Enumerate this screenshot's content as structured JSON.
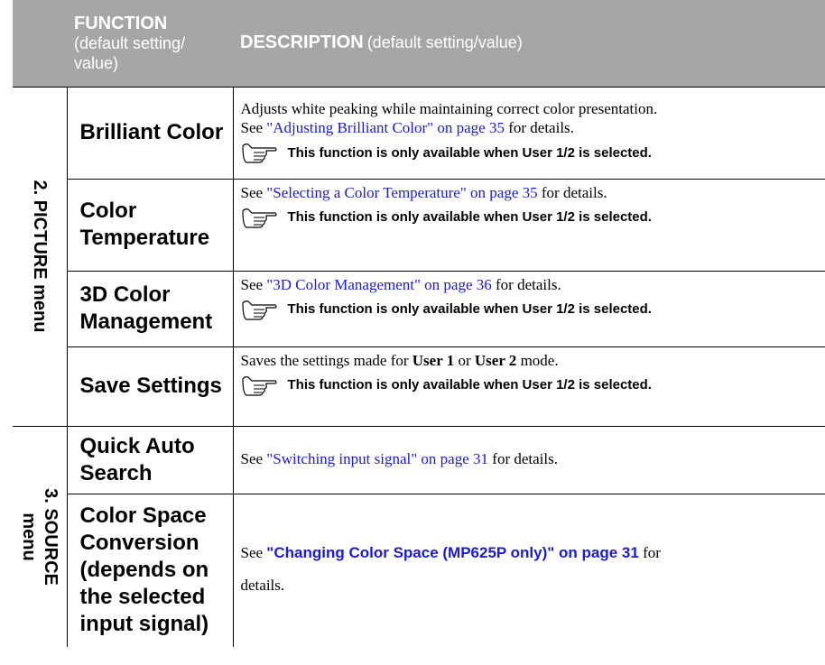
{
  "header": {
    "function_title": "FUNCTION",
    "function_sub": "(default setting/ value)",
    "description_title": "DESCRIPTION",
    "description_sub": "(default setting/value)"
  },
  "note_text": "This function is only available when User 1/2 is selected.",
  "groups": [
    {
      "label": "2. PICTURE menu"
    },
    {
      "label_line1": "3. SOURCE",
      "label_line2": "menu"
    }
  ],
  "rows": {
    "brilliant_color": {
      "function": "Brilliant Color",
      "text1": "Adjusts white peaking while maintaining correct color presentation.",
      "see": "See ",
      "link": "\"Adjusting Brilliant Color\" on page 35",
      "after": " for details."
    },
    "color_temperature": {
      "function_line1": "Color",
      "function_line2": "Temperature",
      "see": "See ",
      "link": "\"Selecting a Color Temperature\" on page 35",
      "after": " for details."
    },
    "color_management": {
      "function_line1": "3D Color",
      "function_line2": "Management",
      "see": "See ",
      "link": "\"3D Color Management\" on page 36",
      "after": " for details."
    },
    "save_settings": {
      "function": "Save Settings",
      "pre": "Saves the settings made for ",
      "user1": "User 1",
      "mid": " or ",
      "user2": "User 2",
      "post": " mode."
    },
    "quick_auto_search": {
      "function_line1": "Quick Auto",
      "function_line2": "Search",
      "see": "See ",
      "link": "\"Switching input signal\" on page 31",
      "after": " for details."
    },
    "color_space": {
      "function_lines": [
        "Color Space",
        "Conversion",
        "(depends on",
        "the selected",
        "input signal)"
      ],
      "see": "See ",
      "link": "\"Changing Color Space (MP625P only)\" on page 31",
      "after": " for",
      "after2": "details."
    }
  },
  "colors": {
    "header_bg": "#a6a6a6",
    "link": "#1a1ad8"
  },
  "icons": [
    "pointing-hand-icon"
  ]
}
